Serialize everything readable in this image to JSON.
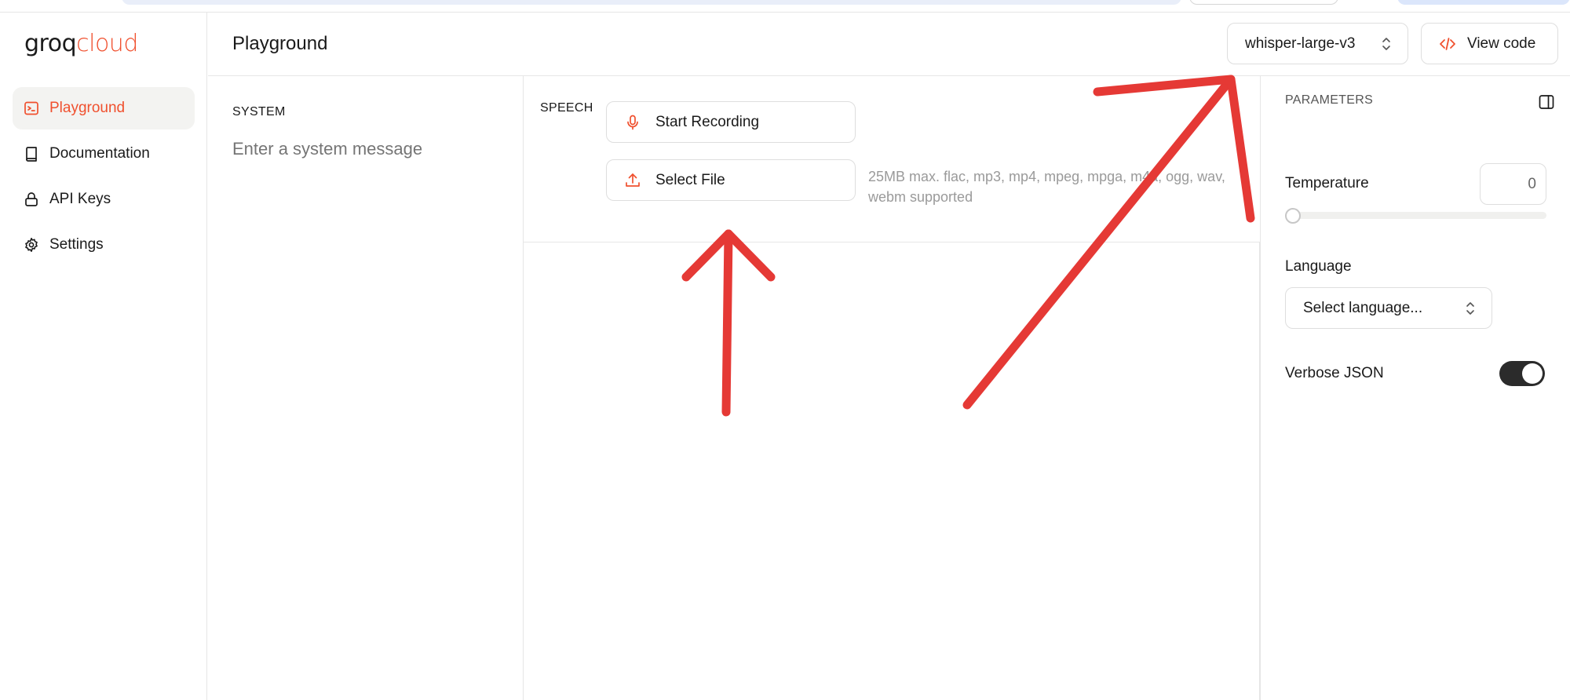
{
  "app": {
    "logo_primary": "groq",
    "logo_secondary": "cloud"
  },
  "sidebar": {
    "items": [
      {
        "label": "Playground",
        "icon": "terminal-icon",
        "active": true
      },
      {
        "label": "Documentation",
        "icon": "book-icon",
        "active": false
      },
      {
        "label": "API Keys",
        "icon": "lock-icon",
        "active": false
      },
      {
        "label": "Settings",
        "icon": "gear-icon",
        "active": false
      }
    ]
  },
  "header": {
    "title": "Playground",
    "model": "whisper-large-v3",
    "view_code_label": "View code"
  },
  "system": {
    "label": "SYSTEM",
    "placeholder": "Enter a system message"
  },
  "speech": {
    "label": "SPEECH",
    "record_label": "Start Recording",
    "file_label": "Select File",
    "file_hint": "25MB max. flac, mp3, mp4, mpeg, mpga, m4a, ogg, wav, webm supported"
  },
  "parameters": {
    "title": "PARAMETERS",
    "temperature_label": "Temperature",
    "temperature_value": "0",
    "language_label": "Language",
    "language_placeholder": "Select language...",
    "verbose_label": "Verbose JSON",
    "verbose_on": true
  },
  "colors": {
    "accent": "#f0502e",
    "annotation_arrow": "#e53935"
  }
}
